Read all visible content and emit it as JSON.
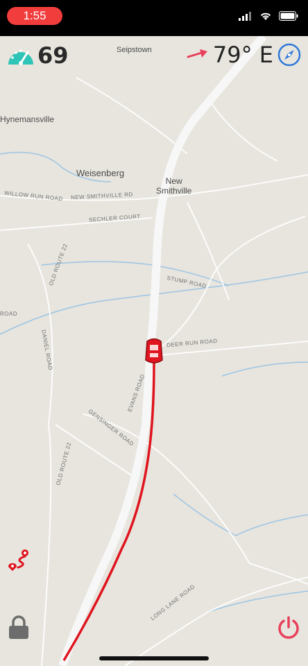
{
  "status": {
    "time": "1:55"
  },
  "hud": {
    "speed": "69",
    "heading": "79° E"
  },
  "map": {
    "places": {
      "seipstown": "Seipstown",
      "hynemansville": "Hynemansville",
      "weisenberg": "Weisenberg",
      "new_smithville": "New\nSmithville"
    },
    "roads": {
      "deer_run": "DEER RUN ROAD",
      "stump": "STUMP ROAD",
      "evans": "EVANS ROAD",
      "gensinger": "GENSINGER ROAD",
      "old_route_22_a": "OLD ROUTE 22",
      "old_route_22_b": "OLD ROUTE 22",
      "long_lane": "LONG LANE ROAD",
      "daniel": "DANIEL ROAD",
      "willow_run": "WILLOW RUN ROAD",
      "new_smithville_rd": "NEW SMITHVILLE RD",
      "sechler_court": "SECHLER COURT",
      "oak_road": "ROAD"
    }
  },
  "colors": {
    "accent_teal": "#2ec4b6",
    "route_red": "#e0141e",
    "heading_arrow": "#e8405a",
    "compass_blue": "#2f79d9",
    "power_red": "#e8405a"
  },
  "icons": {
    "speedometer": "speedometer-icon",
    "compass": "compass-icon",
    "route": "route-icon",
    "lock": "lock-icon",
    "power": "power-icon"
  }
}
